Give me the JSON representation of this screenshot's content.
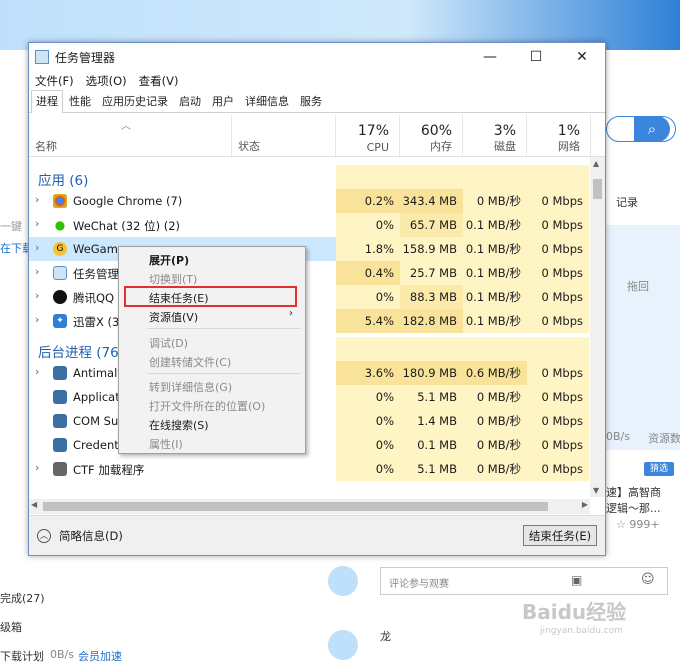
{
  "taskmanager": {
    "title": "任务管理器",
    "menu": [
      "文件(F)",
      "选项(O)",
      "查看(V)"
    ],
    "tabs": [
      "进程",
      "性能",
      "应用历史记录",
      "启动",
      "用户",
      "详细信息",
      "服务"
    ],
    "columns": {
      "name": "名称",
      "status": "状态",
      "cpu_pct": "17%",
      "cpu": "CPU",
      "mem_pct": "60%",
      "mem": "内存",
      "disk_pct": "3%",
      "disk": "磁盘",
      "net_pct": "1%",
      "net": "网络"
    },
    "groups": {
      "apps": "应用 (6)",
      "background": "后台进程 (76"
    },
    "rows": [
      {
        "name": "Google Chrome (7)",
        "cpu": "0.2%",
        "mem": "343.4 MB",
        "disk": "0 MB/秒",
        "net": "0 Mbps",
        "icon": "chrome-icon"
      },
      {
        "name": "WeChat (32 位) (2)",
        "cpu": "0%",
        "mem": "65.7 MB",
        "disk": "0.1 MB/秒",
        "net": "0 Mbps",
        "icon": "wechat-icon"
      },
      {
        "name": "WeGame",
        "cpu": "1.8%",
        "mem": "158.9 MB",
        "disk": "0.1 MB/秒",
        "net": "0 Mbps",
        "icon": "wegame-icon"
      },
      {
        "name": "任务管理器",
        "cpu": "0.4%",
        "mem": "25.7 MB",
        "disk": "0.1 MB/秒",
        "net": "0 Mbps",
        "icon": "taskmgr-icon"
      },
      {
        "name": "腾讯QQ (",
        "cpu": "0%",
        "mem": "88.3 MB",
        "disk": "0.1 MB/秒",
        "net": "0 Mbps",
        "icon": "qq-icon"
      },
      {
        "name": "迅雷X (32",
        "cpu": "5.4%",
        "mem": "182.8 MB",
        "disk": "0.1 MB/秒",
        "net": "0 Mbps",
        "icon": "xunlei-icon"
      },
      {
        "name": "Antimalw",
        "cpu": "3.6%",
        "mem": "180.9 MB",
        "disk": "0.6 MB/秒",
        "net": "0 Mbps",
        "icon": "app-icon"
      },
      {
        "name": "Applicatio",
        "cpu": "0%",
        "mem": "5.1 MB",
        "disk": "0 MB/秒",
        "net": "0 Mbps",
        "icon": "app-icon"
      },
      {
        "name": "COM Sur",
        "cpu": "0%",
        "mem": "1.4 MB",
        "disk": "0 MB/秒",
        "net": "0 Mbps",
        "icon": "app-icon"
      },
      {
        "name": "Credential Guard & Key Guard",
        "cpu": "0%",
        "mem": "0.1 MB",
        "disk": "0 MB/秒",
        "net": "0 Mbps",
        "icon": "app-icon"
      },
      {
        "name": "CTF 加载程序",
        "cpu": "0%",
        "mem": "5.1 MB",
        "disk": "0 MB/秒",
        "net": "0 Mbps",
        "icon": "ctf-icon"
      }
    ],
    "footer": {
      "brief": "简略信息(D)",
      "end_task": "结束任务(E)"
    }
  },
  "context_menu": {
    "expand": "展开(P)",
    "switch_to": "切换到(T)",
    "end_task": "结束任务(E)",
    "resource": "资源值(V)",
    "debug": "调试(D)",
    "dump": "创建转储文件(C)",
    "details": "转到详细信息(G)",
    "open_location": "打开文件所在的位置(O)",
    "search_online": "在线搜索(S)",
    "properties": "属性(I)"
  },
  "background": {
    "record": "记录",
    "drag": "拖回",
    "speed": "0B/s",
    "resource": "资源数",
    "tag": "猜选",
    "snippet1": "速】高智商",
    "snippet2": "逻辑～那...",
    "stars": "999+",
    "done": "完成(27)",
    "box": "级箱",
    "download_plan": "下载计划",
    "download_speed": "0B/s",
    "member": "会员加速",
    "comment_placeholder": "评论参与观赛",
    "user": "龙",
    "watermark": "Baidu经验",
    "watermark_url": "jingyan.baidu.com",
    "left_text": "在下载",
    "first_line": "一键"
  }
}
